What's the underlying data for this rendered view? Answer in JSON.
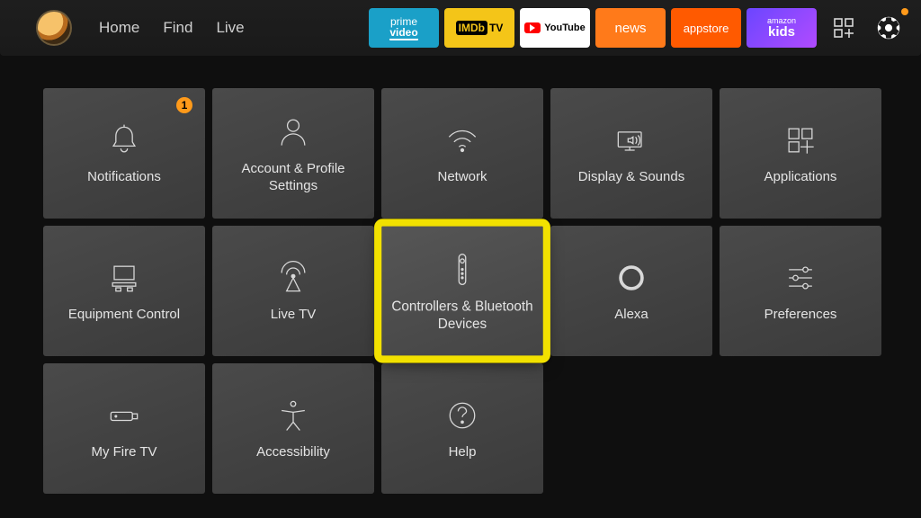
{
  "nav": {
    "home": "Home",
    "find": "Find",
    "live": "Live"
  },
  "apps": {
    "pv1": "prime",
    "pv2": "video",
    "imdb": "IMDb",
    "imdb_tv": "TV",
    "yt": "YouTube",
    "news": "news",
    "appstore": "appstore",
    "kids1": "amazon",
    "kids2": "kids"
  },
  "settings_badge": "1",
  "tiles": {
    "notifications": "Notifications",
    "account": "Account & Profile Settings",
    "network": "Network",
    "display": "Display & Sounds",
    "applications": "Applications",
    "equipment": "Equipment Control",
    "livetv": "Live TV",
    "controllers": "Controllers & Bluetooth Devices",
    "alexa": "Alexa",
    "preferences": "Preferences",
    "myfiretv": "My Fire TV",
    "accessibility": "Accessibility",
    "help": "Help"
  },
  "notifications_count": "1",
  "selected_tile": "controllers"
}
